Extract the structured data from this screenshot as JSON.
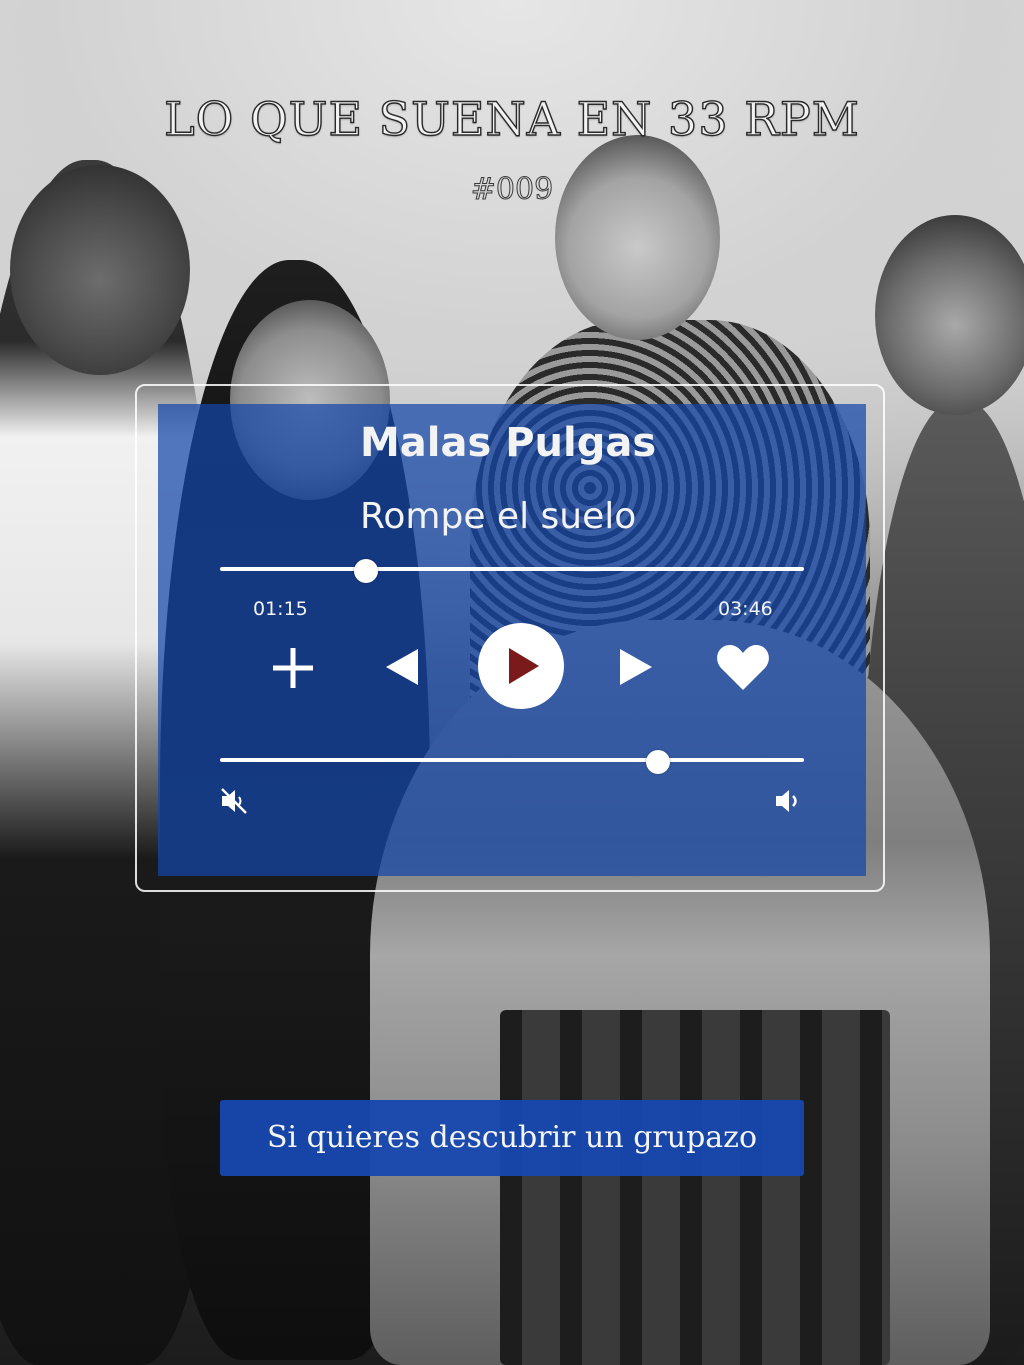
{
  "header": {
    "title": "LO QUE SUENA EN 33 RPM",
    "episode": "#009"
  },
  "player": {
    "artist": "Malas Pulgas",
    "song": "Rompe el suelo",
    "progress_fraction": 0.25,
    "elapsed": "01:15",
    "duration": "03:46",
    "volume_fraction": 0.75,
    "controls": {
      "add_icon": "plus-icon",
      "previous_icon": "previous-icon",
      "play_icon": "play-icon",
      "next_icon": "next-icon",
      "like_icon": "heart-icon",
      "mute_icon": "mute-icon",
      "volume_icon": "volume-icon"
    },
    "colors": {
      "panel": "#1446aa",
      "play_triangle": "#7a1a1a"
    }
  },
  "caption": {
    "text": "Si quieres descubrir un grupazo"
  }
}
